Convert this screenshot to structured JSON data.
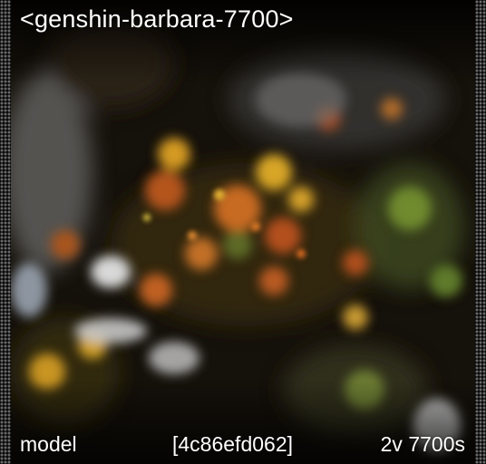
{
  "card": {
    "title": "<genshin-barbara-7700>",
    "footer": {
      "left": "model",
      "middle": "[4c86efd062]",
      "right": "2v 7700s"
    }
  },
  "colors": {
    "background": "#0b0906",
    "text": "#ffffff",
    "border_dots": "#6a6a6a"
  }
}
